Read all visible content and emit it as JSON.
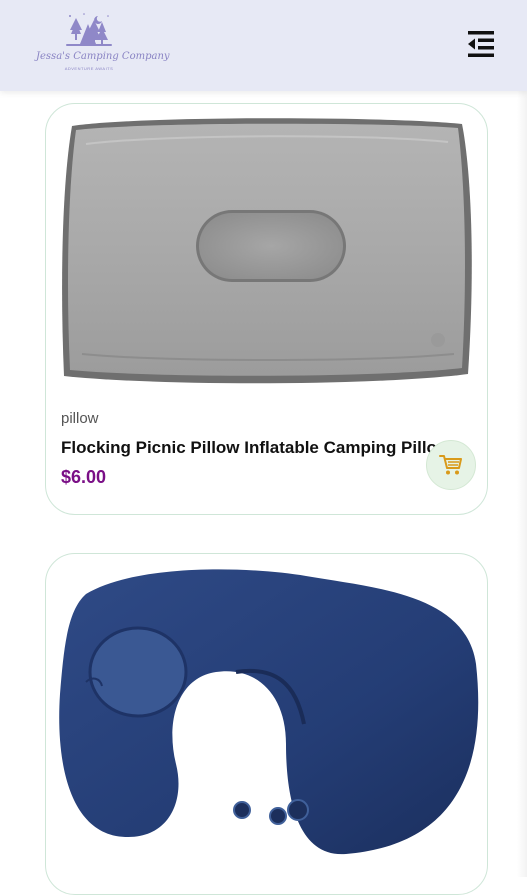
{
  "header": {
    "logo_text": "Jessa's Camping Company",
    "logo_subtext": "ADVENTURE AWAITS",
    "menu_icon": "menu-collapse-icon"
  },
  "products": [
    {
      "category": "pillow",
      "name": "Flocking Picnic Pillow Inflatable Camping Pillow",
      "price": "$6.00",
      "image": "gray-inflatable-pillow",
      "cart_icon": "shopping-cart-icon"
    },
    {
      "image": "navy-inflatable-neck-pillow"
    }
  ],
  "colors": {
    "header_bg": "#e7e9f5",
    "price": "#7a0f86",
    "card_border": "#cfe6d8",
    "cart_button_bg": "#e6f3e6",
    "cart_icon": "#d99a1a"
  }
}
